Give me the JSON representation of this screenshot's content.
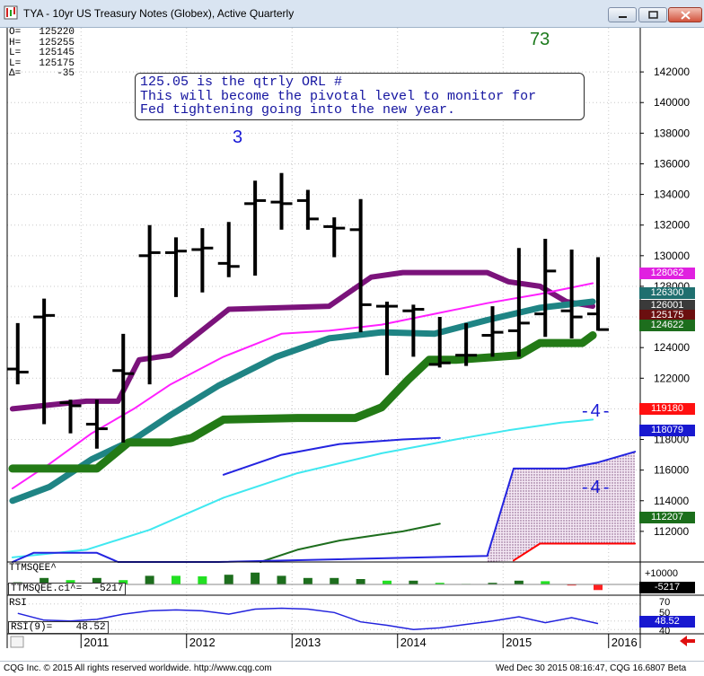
{
  "window": {
    "title": "TYA - 10yr US Treasury Notes (Globex), Active Quarterly",
    "buttons": [
      "minimize",
      "restore",
      "close"
    ]
  },
  "readout": [
    {
      "key": "O=",
      "value": "125220"
    },
    {
      "key": "H=",
      "value": "125255"
    },
    {
      "key": "L=",
      "value": "125145"
    },
    {
      "key": "L=",
      "value": "125175"
    },
    {
      "key": "Δ=",
      "value": "-35"
    }
  ],
  "annotations": {
    "corner_number": "73",
    "wave_3": "3",
    "wave_4_upper": "-4-",
    "wave_4_lower": "-4-",
    "note_lines": [
      "125.05 is the qtrly ORL #",
      "This will become the pivotal level to monitor for",
      "Fed tightening going into the new year."
    ]
  },
  "colors": {
    "purple_ma": "#7b137b",
    "magenta_ma": "#ff20ff",
    "teal_ma": "#1f8484",
    "green_ma": "#237a16",
    "blue_line": "#2424e0",
    "cyan_line": "#40e8f0",
    "dark_green_line": "#1e6e1e",
    "red_line": "#ff0000",
    "bars": "#000000",
    "rsi_line": "#2222dd"
  },
  "price_tags": [
    {
      "label": "128062",
      "bg": "#e020e0"
    },
    {
      "label": "126300",
      "bg": "#1f6f6f"
    },
    {
      "label": "126001",
      "bg": "#3a3a3a"
    },
    {
      "label": "125175",
      "bg": "#6b0f0f"
    },
    {
      "label": "124622",
      "bg": "#1d6e1d"
    },
    {
      "label": "119180",
      "bg": "#ff1010"
    },
    {
      "label": "118079",
      "bg": "#1818d0"
    },
    {
      "label": "112207",
      "bg": "#1b6e1b"
    }
  ],
  "indicators": {
    "squeeze_title": "TTMSQEE^",
    "squeeze_value_label": "TTMSQEE.c1^=",
    "squeeze_value": "-5217",
    "squeeze_axis": "+10000",
    "squeeze_tag": "-5217",
    "rsi_title": "RSI",
    "rsi_value_label": "RSI(9)=",
    "rsi_value": "48.52",
    "rsi_axis": [
      "70",
      "50",
      "40"
    ],
    "rsi_tag": "48.52"
  },
  "status": {
    "copyright": "CQG Inc. © 2015 All rights reserved worldwide. http://www.cqg.com",
    "timestamp": "Wed Dec 30 2015 08:16:47, CQG 16.6807 Beta"
  },
  "chart_data": {
    "type": "bar",
    "title": "TYA - 10yr US Treasury Notes (Globex), Active Quarterly",
    "xlabel": "",
    "ylabel": "",
    "ylim": [
      110000,
      144000
    ],
    "y_ticks": [
      112000,
      114000,
      116000,
      118000,
      120000,
      122000,
      124000,
      126000,
      128000,
      130000,
      132000,
      134000,
      136000,
      138000,
      140000,
      142000
    ],
    "y_tick_labels": [
      "112000",
      "114000",
      "116000",
      "118000",
      "120000",
      "122000",
      "124000",
      "126000",
      "128000",
      "130000",
      "132000",
      "134000",
      "136000",
      "138000",
      "140000",
      "142000"
    ],
    "x_ticks": [
      "2011",
      "2012",
      "2013",
      "2014",
      "2015",
      "2016"
    ],
    "x_range": [
      2010.3,
      2016.3
    ],
    "x_tick_positions": [
      2011,
      2012,
      2013,
      2014,
      2015,
      2016
    ],
    "grid": true,
    "ohlc": [
      {
        "t": 2010.4,
        "o": 122600,
        "h": 125600,
        "l": 121600,
        "c": 122400
      },
      {
        "t": 2010.65,
        "o": 126000,
        "h": 127200,
        "l": 119000,
        "c": 126100
      },
      {
        "t": 2010.9,
        "o": 120400,
        "h": 120600,
        "l": 118400,
        "c": 120200
      },
      {
        "t": 2011.15,
        "o": 119000,
        "h": 120600,
        "l": 117400,
        "c": 118700
      },
      {
        "t": 2011.4,
        "o": 122500,
        "h": 124900,
        "l": 117800,
        "c": 122300
      },
      {
        "t": 2011.65,
        "o": 130000,
        "h": 132000,
        "l": 121600,
        "c": 130200
      },
      {
        "t": 2011.9,
        "o": 130200,
        "h": 131200,
        "l": 127300,
        "c": 130300
      },
      {
        "t": 2012.15,
        "o": 130400,
        "h": 131800,
        "l": 127600,
        "c": 130500
      },
      {
        "t": 2012.4,
        "o": 129500,
        "h": 132200,
        "l": 128600,
        "c": 129300
      },
      {
        "t": 2012.65,
        "o": 133400,
        "h": 134900,
        "l": 128700,
        "c": 133600
      },
      {
        "t": 2012.9,
        "o": 133500,
        "h": 135400,
        "l": 131700,
        "c": 133400
      },
      {
        "t": 2013.15,
        "o": 133600,
        "h": 134300,
        "l": 131700,
        "c": 132400
      },
      {
        "t": 2013.4,
        "o": 131900,
        "h": 132500,
        "l": 129900,
        "c": 131800
      },
      {
        "t": 2013.65,
        "o": 131700,
        "h": 133700,
        "l": 125000,
        "c": 126800
      },
      {
        "t": 2013.9,
        "o": 126700,
        "h": 127000,
        "l": 122200,
        "c": 126700
      },
      {
        "t": 2014.15,
        "o": 126400,
        "h": 126800,
        "l": 123400,
        "c": 126500
      },
      {
        "t": 2014.4,
        "o": 122900,
        "h": 126000,
        "l": 122700,
        "c": 123000
      },
      {
        "t": 2014.65,
        "o": 123500,
        "h": 125600,
        "l": 122800,
        "c": 123500
      },
      {
        "t": 2014.9,
        "o": 124800,
        "h": 126700,
        "l": 123400,
        "c": 125000
      },
      {
        "t": 2015.15,
        "o": 125100,
        "h": 130500,
        "l": 123400,
        "c": 125600
      },
      {
        "t": 2015.4,
        "o": 126200,
        "h": 131100,
        "l": 124700,
        "c": 129000
      },
      {
        "t": 2015.65,
        "o": 126400,
        "h": 130400,
        "l": 124600,
        "c": 126000
      },
      {
        "t": 2015.9,
        "o": 126200,
        "h": 129900,
        "l": 125100,
        "c": 125175
      }
    ],
    "series": [
      {
        "color": "#7b137b",
        "width": 6,
        "x": [
          2010.35,
          2011.05,
          2011.35,
          2011.55,
          2011.85,
          2012.4,
          2013.35,
          2013.75,
          2014.05,
          2014.55,
          2014.85,
          2015.05,
          2015.35,
          2015.6,
          2015.85
        ],
        "y": [
          120000,
          120500,
          120500,
          123200,
          123500,
          126500,
          126700,
          128600,
          128900,
          128900,
          128900,
          128300,
          128000,
          127000,
          126700
        ]
      },
      {
        "color": "#ff20ff",
        "width": 2,
        "x": [
          2010.35,
          2010.7,
          2011.1,
          2011.5,
          2011.85,
          2012.35,
          2012.9,
          2013.35,
          2013.85,
          2014.35,
          2014.85,
          2015.35,
          2015.85
        ],
        "y": [
          114800,
          116400,
          118400,
          120000,
          121600,
          123400,
          124900,
          125100,
          125500,
          126200,
          126900,
          127500,
          128200
        ]
      },
      {
        "color": "#1f8484",
        "width": 7,
        "x": [
          2010.35,
          2010.7,
          2011.1,
          2011.5,
          2011.85,
          2012.3,
          2012.85,
          2013.35,
          2013.85,
          2014.35,
          2014.85,
          2015.35,
          2015.85
        ],
        "y": [
          114000,
          114900,
          116700,
          118000,
          119600,
          121500,
          123400,
          124600,
          125000,
          124900,
          125800,
          126600,
          127000
        ]
      },
      {
        "color": "#237a16",
        "width": 9,
        "x": [
          2010.35,
          2011.15,
          2011.45,
          2011.85,
          2012.05,
          2012.35,
          2013.05,
          2013.6,
          2013.85,
          2014.1,
          2014.3,
          2014.55,
          2015.15,
          2015.35,
          2015.75,
          2015.85
        ],
        "y": [
          116100,
          116100,
          117800,
          117800,
          118100,
          119300,
          119400,
          119400,
          120100,
          121900,
          123200,
          123200,
          123500,
          124300,
          124300,
          124800
        ]
      },
      {
        "color": "#2424e0",
        "width": 2,
        "x": [
          2012.35,
          2012.9,
          2013.45,
          2014.05,
          2014.4
        ],
        "y": [
          115700,
          117000,
          117700,
          118000,
          118100
        ]
      },
      {
        "color": "#40e8f0",
        "width": 2,
        "x": [
          2010.35,
          2011.05,
          2011.65,
          2012.35,
          2013.05,
          2013.85,
          2014.55,
          2015.05,
          2015.55,
          2015.85
        ],
        "y": [
          110300,
          110800,
          112100,
          114200,
          115800,
          117100,
          118000,
          118600,
          119100,
          119300
        ]
      },
      {
        "color": "#1e6e1e",
        "width": 2,
        "x": [
          2012.7,
          2013.05,
          2013.45,
          2013.85,
          2014.05,
          2014.4
        ],
        "y": [
          110000,
          110800,
          111400,
          111800,
          112000,
          112500
        ]
      },
      {
        "color": "#2424e0",
        "width": 2,
        "x": [
          2010.35,
          2010.55,
          2011.15,
          2011.35,
          2012.3,
          2014.85,
          2015.1,
          2015.35,
          2015.6,
          2015.9,
          2016.25
        ],
        "y": [
          110000,
          110600,
          110600,
          110000,
          110000,
          110400,
          116100,
          116100,
          116100,
          116500,
          117200
        ]
      },
      {
        "color": "#ff0000",
        "width": 2,
        "x": [
          2015.1,
          2015.35,
          2016.25
        ],
        "y": [
          110100,
          111200,
          111200
        ]
      }
    ],
    "squeeze_bars": {
      "x": [
        2010.4,
        2010.65,
        2010.9,
        2011.15,
        2011.4,
        2011.65,
        2011.9,
        2012.15,
        2012.4,
        2012.65,
        2012.9,
        2013.15,
        2013.4,
        2013.65,
        2013.9,
        2014.15,
        2014.4,
        2014.65,
        2014.9,
        2015.15,
        2015.4,
        2015.65,
        2015.9
      ],
      "values": [
        2000,
        6000,
        4000,
        6000,
        4000,
        8000,
        8000,
        7500,
        9000,
        11000,
        8000,
        6000,
        6000,
        5000,
        3500,
        3500,
        1500,
        500,
        1500,
        3500,
        3000,
        -1000,
        -5217
      ],
      "colors": [
        "#1d6e1d",
        "#1d6e1d",
        "#22e022",
        "#1d6e1d",
        "#22e022",
        "#1d6e1d",
        "#22e022",
        "#22e022",
        "#1d6e1d",
        "#1d6e1d",
        "#1d6e1d",
        "#1d6e1d",
        "#1d6e1d",
        "#1d6e1d",
        "#22e022",
        "#1d6e1d",
        "#22e022",
        "#22e022",
        "#1d6e1d",
        "#1d6e1d",
        "#22e022",
        "#ff2020",
        "#ff2020"
      ]
    },
    "rsi": {
      "ylim": [
        35,
        75
      ],
      "x": [
        2010.4,
        2010.65,
        2010.9,
        2011.15,
        2011.4,
        2011.65,
        2011.9,
        2012.15,
        2012.4,
        2012.65,
        2012.9,
        2013.15,
        2013.4,
        2013.65,
        2013.9,
        2014.15,
        2014.4,
        2014.65,
        2014.9,
        2015.15,
        2015.4,
        2015.65,
        2015.9
      ],
      "values": [
        59,
        51,
        50,
        52,
        58,
        62,
        63,
        62,
        58,
        64,
        65,
        64,
        60,
        49,
        45,
        40,
        42,
        46,
        50,
        55,
        48,
        54,
        47
      ]
    }
  }
}
